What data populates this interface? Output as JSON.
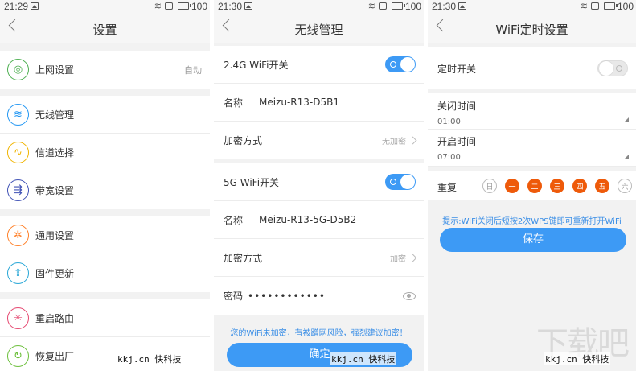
{
  "screen1": {
    "status": {
      "time": "21:29",
      "battery": "100"
    },
    "title": "设置",
    "group1": [
      {
        "label": "上网设置",
        "right": "自动",
        "icon": "globe-icon"
      }
    ],
    "group2": [
      {
        "label": "无线管理",
        "icon": "wifi-icon"
      },
      {
        "label": "信道选择",
        "icon": "signal-wave-icon"
      },
      {
        "label": "带宽设置",
        "icon": "bandwidth-icon"
      }
    ],
    "group3": [
      {
        "label": "通用设置",
        "icon": "gear-icon"
      },
      {
        "label": "固件更新",
        "icon": "upload-icon"
      }
    ],
    "group4": [
      {
        "label": "重启路由",
        "icon": "restart-icon"
      },
      {
        "label": "恢复出厂",
        "icon": "reset-icon"
      }
    ]
  },
  "screen2": {
    "status": {
      "time": "21:30",
      "battery": "100"
    },
    "title": "无线管理",
    "wifi24": {
      "switch_label": "2.4G WiFi开关",
      "switch_on": true,
      "name_label": "名称",
      "name_value": "Meizu-R13-D5B1",
      "enc_label": "加密方式",
      "enc_value": "无加密"
    },
    "wifi5": {
      "switch_label": "5G WiFi开关",
      "switch_on": true,
      "name_label": "名称",
      "name_value": "Meizu-R13-5G-D5B2",
      "enc_label": "加密方式",
      "enc_value": "加密",
      "pwd_label": "密码",
      "pwd_value": "••••••••••••"
    },
    "warning": "您的WiFi未加密，有被蹭网风险，强烈建议加密！",
    "confirm_label": "确定"
  },
  "screen3": {
    "status": {
      "time": "21:30",
      "battery": "100"
    },
    "title": "WiFi定时设置",
    "timer_label": "定时开关",
    "timer_on": false,
    "off_time_label": "关闭时间",
    "off_time_value": "01:00",
    "on_time_label": "开启时间",
    "on_time_value": "07:00",
    "repeat_label": "重复",
    "days": [
      {
        "label": "日",
        "selected": false
      },
      {
        "label": "一",
        "selected": true
      },
      {
        "label": "二",
        "selected": true
      },
      {
        "label": "三",
        "selected": true
      },
      {
        "label": "四",
        "selected": true
      },
      {
        "label": "五",
        "selected": true
      },
      {
        "label": "六",
        "selected": false
      }
    ],
    "tip": "提示:WiFi关闭后短按2次WPS键即可重新打开WiFi",
    "save_label": "保存"
  },
  "watermark": {
    "text": "kkj.cn 快科技",
    "big": "下载吧"
  },
  "colors": {
    "accent": "#3d9af5",
    "day_selected": "#ee5a0a"
  }
}
